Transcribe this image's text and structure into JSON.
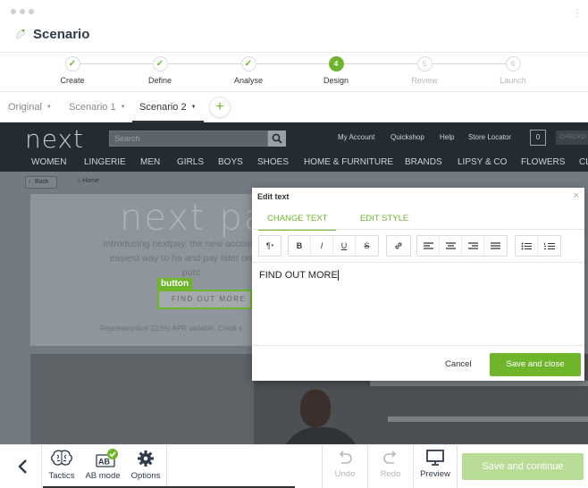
{
  "app": {
    "title": "Scenario"
  },
  "stepper": [
    {
      "num": "✓",
      "label": "Create",
      "state": "done"
    },
    {
      "num": "✓",
      "label": "Define",
      "state": "done"
    },
    {
      "num": "✓",
      "label": "Analyse",
      "state": "done"
    },
    {
      "num": "4",
      "label": "Design",
      "state": "active"
    },
    {
      "num": "5",
      "label": "Review",
      "state": "future"
    },
    {
      "num": "6",
      "label": "Launch",
      "state": "future"
    }
  ],
  "tabs": [
    {
      "label": "Original",
      "active": false
    },
    {
      "label": "Scenario 1",
      "active": false
    },
    {
      "label": "Scenario 2",
      "active": true
    }
  ],
  "add_tab": "+",
  "site": {
    "logo": "next",
    "search_placeholder": "Search",
    "links": [
      "My Account",
      "Quickshop",
      "Help",
      "Store Locator"
    ],
    "bag_count": "0",
    "checkout": "CHECKO",
    "nav": [
      "WOMEN",
      "LINGERIE",
      "MEN",
      "GIRLS",
      "BOYS",
      "SHOES",
      "HOME & FURNITURE",
      "BRANDS",
      "LIPSY & CO",
      "FLOWERS",
      "CL"
    ],
    "back": "Back",
    "home": "Home",
    "hero_title": "next pa",
    "hero_copy": "Introducing nextpay, the new account. The easiest way to ha and pay later on your purc",
    "hero_apr": "Representative 22.9% APR variable. Credit s",
    "button_tag": "button",
    "button_text": "FIND OUT MORE"
  },
  "modal": {
    "title": "Edit text",
    "close": "×",
    "tab_change": "CHANGE TEXT",
    "tab_edit": "EDIT STYLE",
    "editor_text": "FIND OUT MORE",
    "cancel": "Cancel",
    "save": "Save and close"
  },
  "bottom": {
    "tactics": "Tactics",
    "ab_mode": "AB mode",
    "options": "Options",
    "undo": "Undo",
    "redo": "Redo",
    "preview": "Preview",
    "save_continue": "Save and continue"
  },
  "colors": {
    "accent": "#6fb52c",
    "header_dark": "#232b33"
  }
}
